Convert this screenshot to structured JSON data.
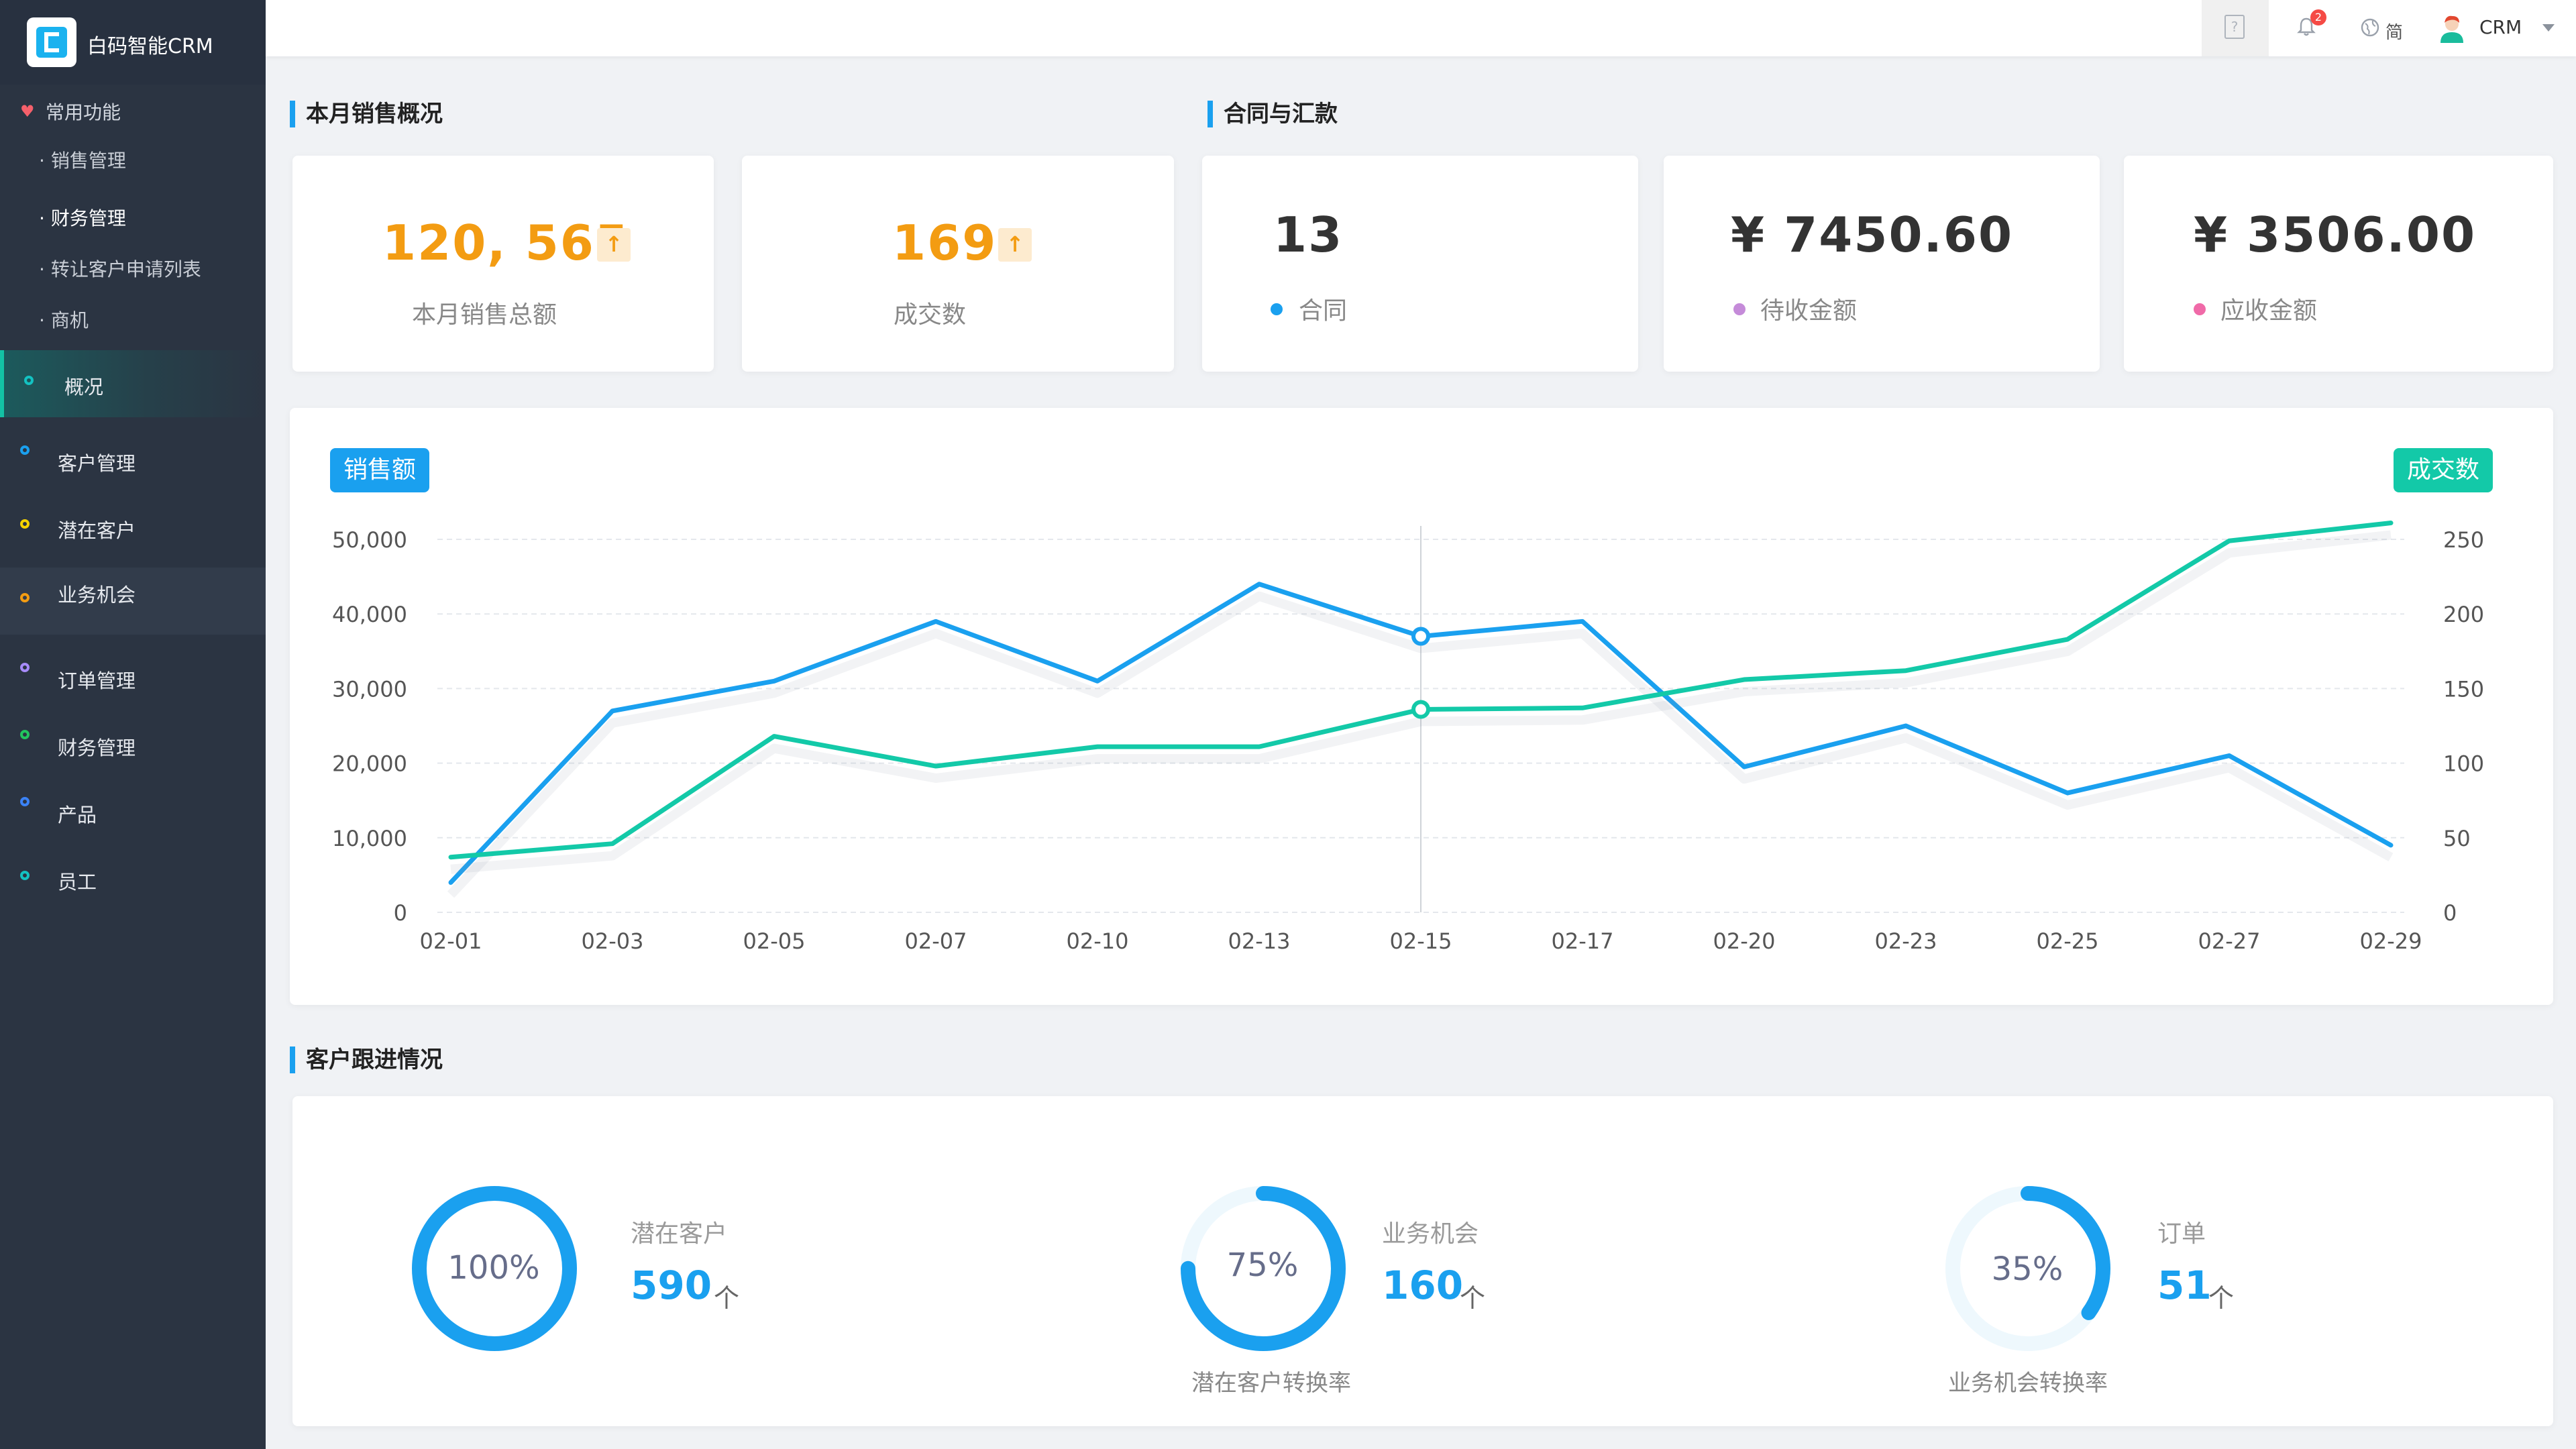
{
  "app": {
    "name": "白码智能CRM"
  },
  "sidebar": {
    "favorites_title": "常用功能",
    "favorites": [
      "销售管理",
      "财务管理",
      "转让客户申请列表",
      "商机"
    ],
    "nav": [
      {
        "label": "概况",
        "color": "#13c2c2"
      },
      {
        "label": "客户管理",
        "color": "#1aa0ef"
      },
      {
        "label": "潜在客户",
        "color": "#f5d300"
      },
      {
        "label": "业务机会",
        "color": "#f39c12"
      },
      {
        "label": "订单管理",
        "color": "#a78bfa"
      },
      {
        "label": "财务管理",
        "color": "#22c55e"
      },
      {
        "label": "产品",
        "color": "#3b82f6"
      },
      {
        "label": "员工",
        "color": "#13c2c2"
      }
    ]
  },
  "header": {
    "notifications": "2",
    "language": "简",
    "user": "CRM"
  },
  "sales_section": {
    "title": "本月销售概况",
    "total_value": "120, 565",
    "total_label": "本月销售总额",
    "deals_value": "169",
    "deals_label": "成交数",
    "up_icon": "up-arrow-icon"
  },
  "contract_section": {
    "title": "合同与汇款",
    "contracts_value": "13",
    "contracts_label": "合同",
    "pending_value": "¥ 7450.60",
    "pending_label": "待收金额",
    "receivable_value": "¥ 3506.00",
    "receivable_label": "应收金额",
    "colors": {
      "contracts": "#1aa0ef",
      "pending": "#c58bd9",
      "receivable": "#f06aa8"
    }
  },
  "chart_data": {
    "type": "line",
    "categories": [
      "02-01",
      "02-03",
      "02-05",
      "02-07",
      "02-10",
      "02-13",
      "02-15",
      "02-17",
      "02-20",
      "02-23",
      "02-25",
      "02-27",
      "02-29"
    ],
    "series": [
      {
        "name": "销售额",
        "axis": "left",
        "color": "#1aa0ef",
        "values": [
          4000,
          27000,
          31000,
          39000,
          31000,
          44000,
          37000,
          39000,
          19500,
          25000,
          16000,
          21000,
          9000
        ]
      },
      {
        "name": "成交数",
        "axis": "right",
        "color": "#13c9a8",
        "values": [
          37,
          46,
          118,
          98,
          111,
          111,
          136,
          137,
          156,
          162,
          183,
          249,
          261
        ]
      }
    ],
    "y_left": {
      "ticks": [
        "0",
        "10,000",
        "20,000",
        "30,000",
        "40,000",
        "50,000"
      ],
      "range": [
        0,
        50000
      ]
    },
    "y_right": {
      "ticks": [
        "0",
        "50",
        "100",
        "150",
        "200",
        "250"
      ],
      "range": [
        0,
        250
      ]
    },
    "highlight_index": 6,
    "grid": true
  },
  "followup_section": {
    "title": "客户跟进情况",
    "items": [
      {
        "label": "潜在客户",
        "value": "590",
        "unit": "个",
        "percent_text": "100%",
        "percent": 100,
        "caption": ""
      },
      {
        "label": "业务机会",
        "value": "160",
        "unit": "个",
        "percent_text": "75%",
        "percent": 75,
        "caption": "潜在客户转换率"
      },
      {
        "label": "订单",
        "value": "51",
        "unit": "个",
        "percent_text": "35%",
        "percent": 35,
        "caption": "业务机会转换率"
      }
    ]
  }
}
